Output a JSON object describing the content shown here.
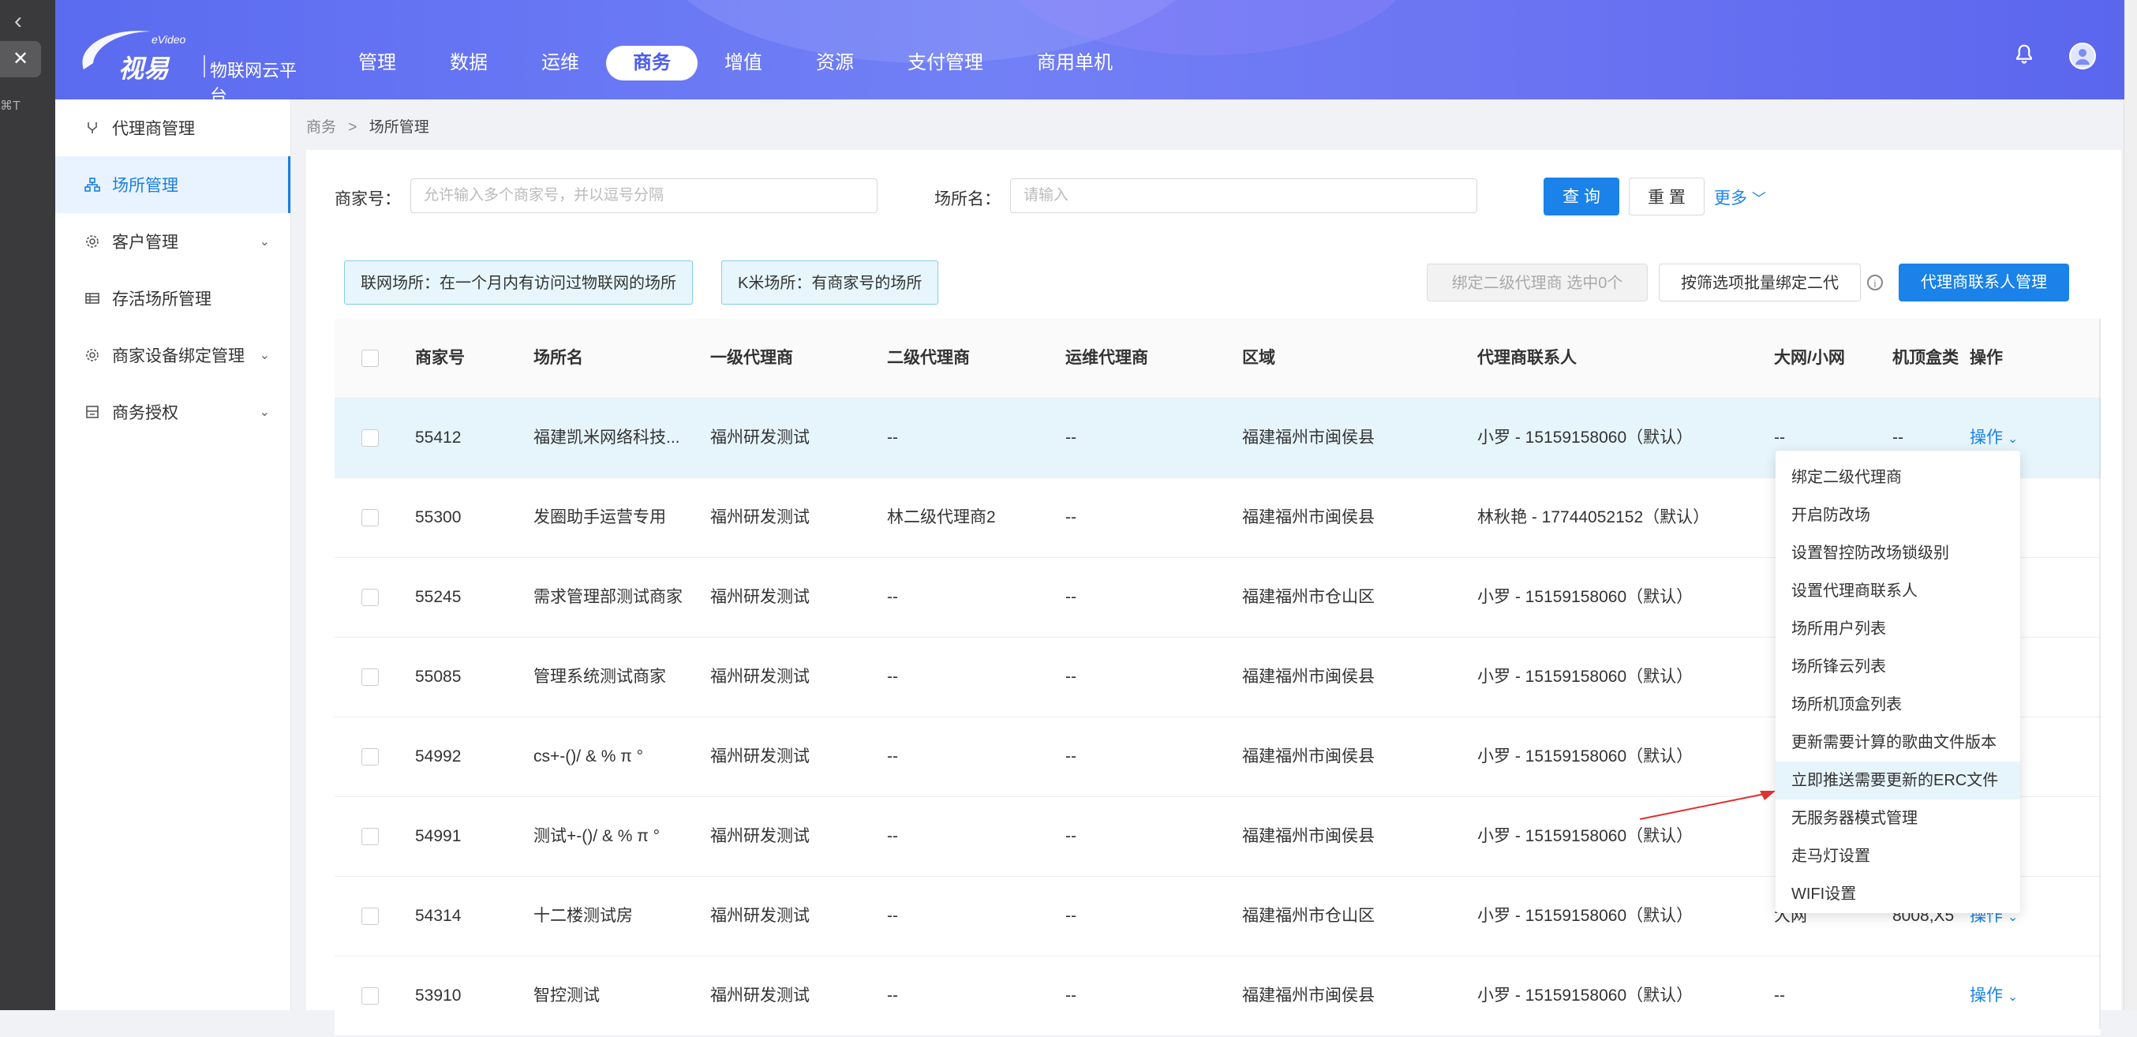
{
  "header": {
    "logo_brand": "视易",
    "logo_small": "eVideo",
    "logo_name": "物联网云平台",
    "nav": [
      "管理",
      "数据",
      "运维",
      "商务",
      "增值",
      "资源",
      "支付管理",
      "商用单机"
    ],
    "active_nav": "商务"
  },
  "mac": {
    "back": "‹",
    "close": "✕",
    "shortcut": "⌘T"
  },
  "sidebar": {
    "items": [
      {
        "label": "代理商管理",
        "icon": "branch-icon"
      },
      {
        "label": "场所管理",
        "icon": "org-chart-icon",
        "active": true
      },
      {
        "label": "客户管理",
        "icon": "gear-icon",
        "expandable": true
      },
      {
        "label": "存活场所管理",
        "icon": "table-icon"
      },
      {
        "label": "商家设备绑定管理",
        "icon": "gear-icon",
        "expandable": true
      },
      {
        "label": "商务授权",
        "icon": "printer-icon",
        "expandable": true
      }
    ]
  },
  "breadcrumb": {
    "parent": "商务",
    "sep": ">",
    "current": "场所管理"
  },
  "filters": {
    "merchant_label": "商家号：",
    "merchant_placeholder": "允许输入多个商家号，并以逗号分隔",
    "venue_label": "场所名：",
    "venue_placeholder": "请输入",
    "query_btn": "查 询",
    "reset_btn": "重 置",
    "more": "更多"
  },
  "tags": {
    "online": "联网场所：在一个月内有访问过物联网的场所",
    "kmi": "K米场所：有商家号的场所"
  },
  "actions": {
    "bind_second": "绑定二级代理商 选中0个",
    "batch_bind": "按筛选项批量绑定二代",
    "contact_manage": "代理商联系人管理"
  },
  "table": {
    "columns": [
      "商家号",
      "场所名",
      "一级代理商",
      "二级代理商",
      "运维代理商",
      "区域",
      "代理商联系人",
      "大网/小网",
      "机顶盒类",
      "操作"
    ],
    "rows": [
      {
        "id": "55412",
        "name": "福建凯米网络科技...",
        "l1": "福州研发测试",
        "l2": "--",
        "ops": "--",
        "region": "福建福州市闽侯县",
        "contact": "小罗 - 15159158060（默认）",
        "net": "--",
        "box": "--",
        "op": "操作"
      },
      {
        "id": "55300",
        "name": "发圈助手运营专用",
        "l1": "福州研发测试",
        "l2": "林二级代理商2",
        "ops": "--",
        "region": "福建福州市闽侯县",
        "contact": "林秋艳 - 17744052152（默认）",
        "net": "",
        "box": "",
        "op": ""
      },
      {
        "id": "55245",
        "name": "需求管理部测试商家",
        "l1": "福州研发测试",
        "l2": "--",
        "ops": "--",
        "region": "福建福州市仓山区",
        "contact": "小罗 - 15159158060（默认）",
        "net": "",
        "box": "",
        "op": ""
      },
      {
        "id": "55085",
        "name": "管理系统测试商家",
        "l1": "福州研发测试",
        "l2": "--",
        "ops": "--",
        "region": "福建福州市闽侯县",
        "contact": "小罗 - 15159158060（默认）",
        "net": "",
        "box": "",
        "op": ""
      },
      {
        "id": "54992",
        "name": "cs+-()/ & % π °",
        "l1": "福州研发测试",
        "l2": "--",
        "ops": "--",
        "region": "福建福州市闽侯县",
        "contact": "小罗 - 15159158060（默认）",
        "net": "",
        "box": "",
        "op": ""
      },
      {
        "id": "54991",
        "name": "测试+-()/ & % π °",
        "l1": "福州研发测试",
        "l2": "--",
        "ops": "--",
        "region": "福建福州市闽侯县",
        "contact": "小罗 - 15159158060（默认）",
        "net": "",
        "box": "",
        "op": ""
      },
      {
        "id": "54314",
        "name": "十二楼测试房",
        "l1": "福州研发测试",
        "l2": "--",
        "ops": "--",
        "region": "福建福州市仓山区",
        "contact": "小罗 - 15159158060（默认）",
        "net": "大网",
        "box": "8008,X5",
        "op": "操作"
      },
      {
        "id": "53910",
        "name": "智控测试",
        "l1": "福州研发测试",
        "l2": "--",
        "ops": "--",
        "region": "福建福州市闽侯县",
        "contact": "小罗 - 15159158060（默认）",
        "net": "--",
        "box": "",
        "op": "操作"
      }
    ]
  },
  "dropdown": {
    "items": [
      "绑定二级代理商",
      "开启防改场",
      "设置智控防改场锁级别",
      "设置代理商联系人",
      "场所用户列表",
      "场所锋云列表",
      "场所机顶盒列表",
      "更新需要计算的歌曲文件版本",
      "立即推送需要更新的ERC文件",
      "无服务器模式管理",
      "走马灯设置",
      "WIFI设置"
    ],
    "highlighted_index": 8
  },
  "colors": {
    "primary": "#1a82e8",
    "header": "#6a78f4",
    "annotation_arrow": "#e03030"
  }
}
